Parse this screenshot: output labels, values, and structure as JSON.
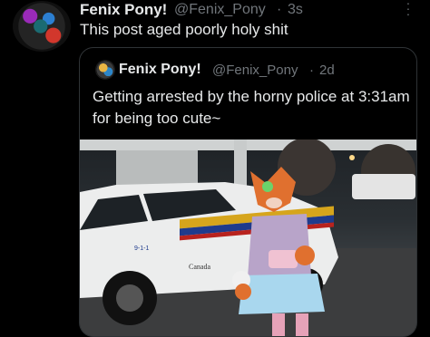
{
  "post": {
    "author_name": "Fenix Pony!",
    "author_handle": "@Fenix_Pony",
    "separator": "·",
    "timestamp": "3s",
    "text": "This post aged poorly holy shit"
  },
  "quoted_post": {
    "author_name": "Fenix Pony!",
    "author_handle": "@Fenix_Pony",
    "separator": "·",
    "timestamp": "2d",
    "text": "Getting arrested by the horny police at 3:31am for being too cute~",
    "image": {
      "car_door_text": "Canada",
      "car_number_text": "9-1-1"
    }
  },
  "icons": {
    "more": "more-options-icon"
  }
}
